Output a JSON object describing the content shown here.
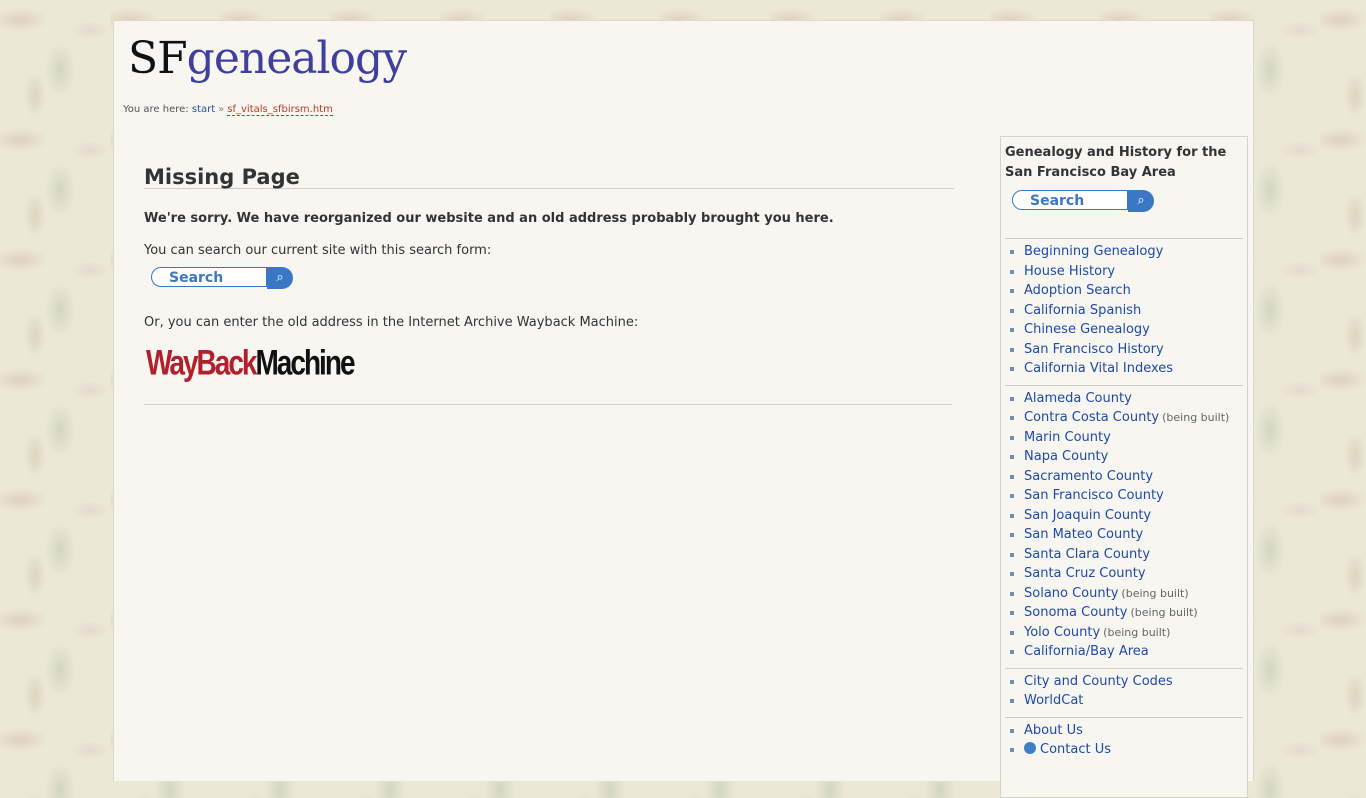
{
  "logo": {
    "part1": "SF",
    "part2": "genealogy"
  },
  "breadcrumb": {
    "prefix": "You are here:",
    "home": "start",
    "separator": "»",
    "current": "sf_vitals_sfbirsm.htm"
  },
  "main": {
    "title": "Missing Page",
    "sorry": "We're sorry. We have reorganized our website and an old address probably brought you here.",
    "search_text": "You can search our current site with this search form:",
    "search_label": "Search",
    "wayback_text": "Or, you can enter the old address in the Internet Archive Wayback Machine:",
    "wayback_logo": {
      "part1": "WayBack",
      "part2": "Machine"
    }
  },
  "sidebar": {
    "heading": "Genealogy and History for the San Francisco Bay Area",
    "search_label": "Search",
    "group1": [
      {
        "label": "Beginning Genealogy"
      },
      {
        "label": "House History"
      },
      {
        "label": "Adoption Search"
      },
      {
        "label": "California Spanish"
      },
      {
        "label": "Chinese Genealogy"
      },
      {
        "label": "San Francisco History"
      },
      {
        "label": "California Vital Indexes"
      }
    ],
    "group2": [
      {
        "label": "Alameda County",
        "note": ""
      },
      {
        "label": "Contra Costa County",
        "note": "(being built)"
      },
      {
        "label": "Marin County",
        "note": ""
      },
      {
        "label": "Napa County",
        "note": ""
      },
      {
        "label": "Sacramento County",
        "note": ""
      },
      {
        "label": "San Francisco County",
        "note": ""
      },
      {
        "label": "San Joaquin County",
        "note": ""
      },
      {
        "label": "San Mateo County",
        "note": ""
      },
      {
        "label": "Santa Clara County",
        "note": ""
      },
      {
        "label": "Santa Cruz County",
        "note": ""
      },
      {
        "label": "Solano County",
        "note": "(being built)"
      },
      {
        "label": "Sonoma County",
        "note": "(being built)"
      },
      {
        "label": "Yolo County",
        "note": "(being built)"
      },
      {
        "label": "California/Bay Area",
        "note": ""
      }
    ],
    "group3": [
      {
        "label": "City and County Codes"
      },
      {
        "label": "WorldCat"
      }
    ],
    "group4": [
      {
        "label": "About Us"
      },
      {
        "label": "Contact Us"
      }
    ]
  }
}
